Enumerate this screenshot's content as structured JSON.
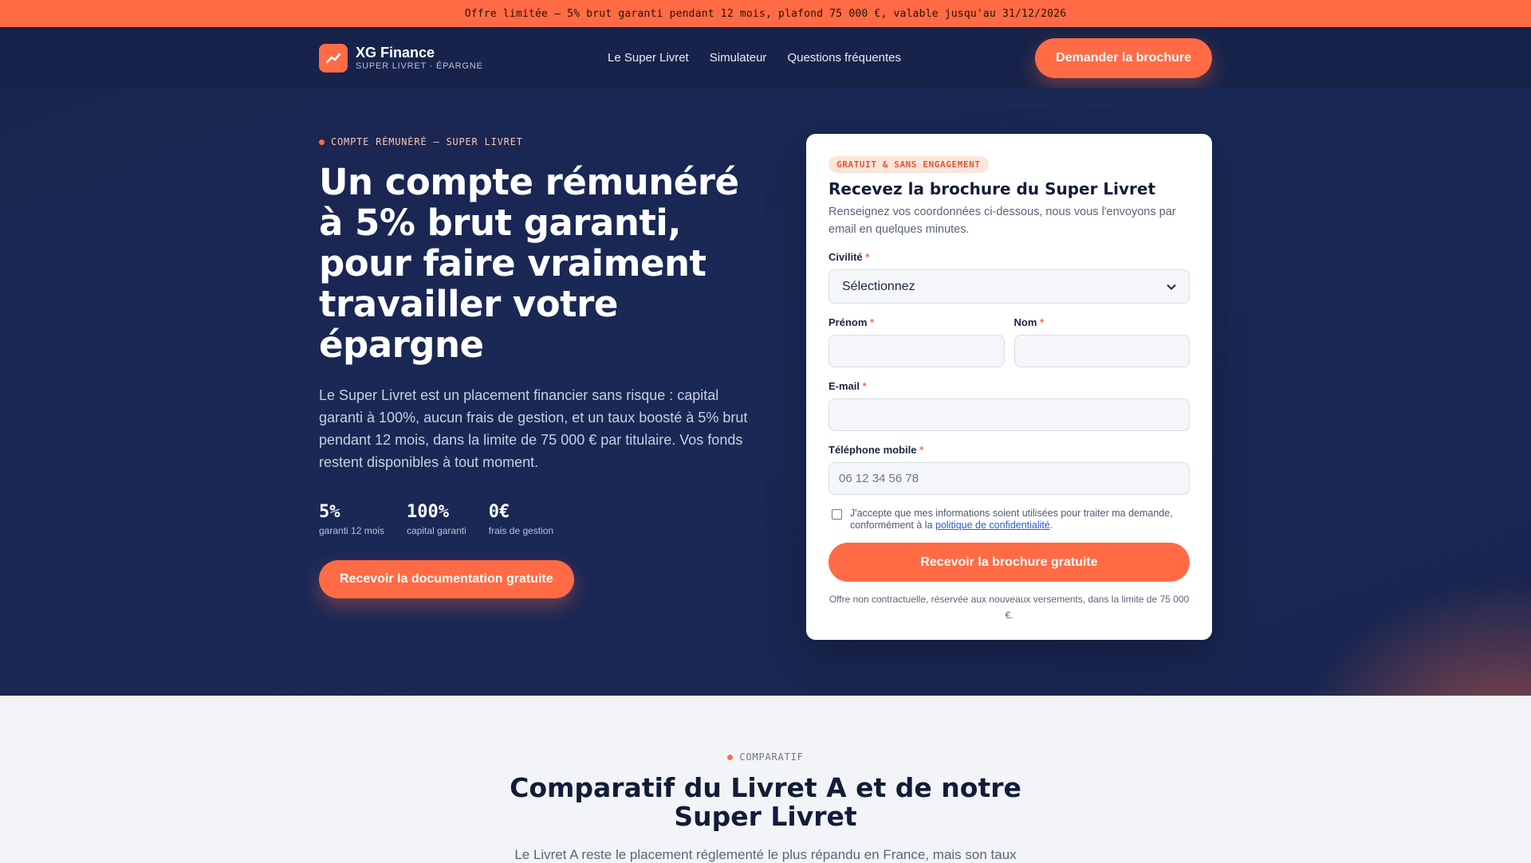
{
  "topbar": {
    "text": "Offre limitée — 5% brut garanti pendant 12 mois, plafond 75 000 €, valable jusqu'au 31/12/2026"
  },
  "nav": {
    "brand_name": "XG Finance",
    "brand_sub": "SUPER LIVRET · ÉPARGNE",
    "links": [
      "Le Super Livret",
      "Simulateur",
      "Questions fréquentes"
    ],
    "cta": "Demander la brochure"
  },
  "hero": {
    "eyebrow": "COMPTE RÉMUNÉRÉ — SUPER LIVRET",
    "title": "Un compte rémunéré à 5% brut garanti, pour faire vraiment travailler votre épargne",
    "description": "Le Super Livret est un placement financier sans risque : capital garanti à 100%, aucun frais de gestion, et un taux boosté à 5% brut pendant 12 mois, dans la limite de 75 000 € par titulaire. Vos fonds restent disponibles à tout moment.",
    "stats": [
      {
        "value": "5%",
        "label": "garanti 12 mois"
      },
      {
        "value": "100%",
        "label": "capital garanti"
      },
      {
        "value": "0€",
        "label": "frais de gestion"
      }
    ],
    "cta": "Recevoir la documentation gratuite"
  },
  "form": {
    "badge": "GRATUIT & SANS ENGAGEMENT",
    "title": "Recevez la brochure du Super Livret",
    "subtitle": "Renseignez vos coordonnées ci-dessous, nous vous l'envoyons par email en quelques minutes.",
    "civilite_label": "Civilité",
    "civilite_value": "Sélectionnez",
    "prenom_label": "Prénom",
    "nom_label": "Nom",
    "email_label": "E-mail",
    "phone_label": "Téléphone mobile",
    "phone_placeholder": "06 12 34 56 78",
    "required_mark": "*",
    "consent_text": "J'accepte que mes informations soient utilisées pour traiter ma demande, conformément à la ",
    "consent_link": "politique de confidentialité",
    "consent_end": ".",
    "submit": "Recevoir la brochure gratuite",
    "disclaimer": "Offre non contractuelle, réservée aux nouveaux versements, dans la limite de 75 000 €."
  },
  "compare": {
    "eyebrow": "COMPARATIF",
    "title_line1": "Comparatif du Livret A et de notre",
    "title_line2": "Super Livret",
    "text": "Le Livret A reste le placement réglementé le plus répandu en France, mais son taux"
  },
  "colors": {
    "accent": "#ff6b45",
    "navy": "#17234a"
  }
}
